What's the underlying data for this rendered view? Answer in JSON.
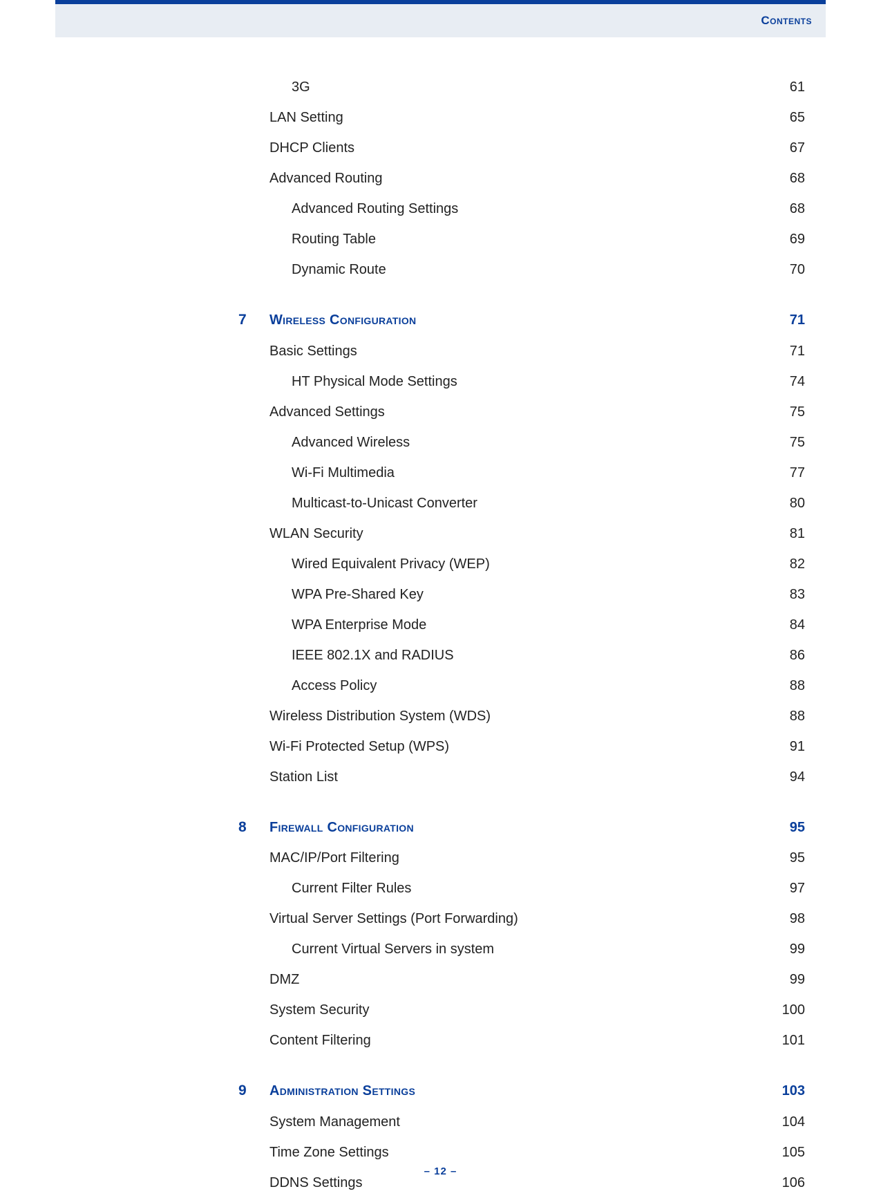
{
  "header": {
    "label": "Contents"
  },
  "footer": {
    "page_label": "–  12  –"
  },
  "toc": [
    {
      "level": 2,
      "label": "3G",
      "page": "61"
    },
    {
      "level": 1,
      "label": "LAN Setting",
      "page": "65"
    },
    {
      "level": 1,
      "label": "DHCP Clients",
      "page": "67"
    },
    {
      "level": 1,
      "label": "Advanced Routing",
      "page": "68"
    },
    {
      "level": 2,
      "label": "Advanced Routing Settings",
      "page": "68"
    },
    {
      "level": 2,
      "label": "Routing Table",
      "page": "69"
    },
    {
      "level": 2,
      "label": "Dynamic Route",
      "page": "70"
    },
    {
      "level": 0,
      "chapter_num": "7",
      "label": "Wireless Configuration",
      "page": "71"
    },
    {
      "level": 1,
      "label": "Basic Settings",
      "page": "71"
    },
    {
      "level": 2,
      "label": "HT Physical Mode Settings",
      "page": "74"
    },
    {
      "level": 1,
      "label": "Advanced Settings",
      "page": "75"
    },
    {
      "level": 2,
      "label": "Advanced Wireless",
      "page": "75"
    },
    {
      "level": 2,
      "label": "Wi-Fi Multimedia",
      "page": "77"
    },
    {
      "level": 2,
      "label": "Multicast-to-Unicast Converter",
      "page": "80"
    },
    {
      "level": 1,
      "label": "WLAN Security",
      "page": "81"
    },
    {
      "level": 2,
      "label": "Wired Equivalent Privacy (WEP)",
      "page": "82"
    },
    {
      "level": 2,
      "label": "WPA Pre-Shared Key",
      "page": "83"
    },
    {
      "level": 2,
      "label": "WPA Enterprise Mode",
      "page": "84"
    },
    {
      "level": 2,
      "label": "IEEE 802.1X and RADIUS",
      "page": "86"
    },
    {
      "level": 2,
      "label": "Access Policy",
      "page": "88"
    },
    {
      "level": 1,
      "label": "Wireless Distribution System (WDS)",
      "page": "88"
    },
    {
      "level": 1,
      "label": "Wi-Fi Protected Setup (WPS)",
      "page": "91"
    },
    {
      "level": 1,
      "label": "Station List",
      "page": "94"
    },
    {
      "level": 0,
      "chapter_num": "8",
      "label": "Firewall Configuration",
      "page": "95"
    },
    {
      "level": 1,
      "label": "MAC/IP/Port Filtering",
      "page": "95"
    },
    {
      "level": 2,
      "label": "Current Filter Rules",
      "page": "97"
    },
    {
      "level": 1,
      "label": "Virtual Server Settings (Port Forwarding)",
      "page": "98"
    },
    {
      "level": 2,
      "label": "Current Virtual Servers in system",
      "page": "99"
    },
    {
      "level": 1,
      "label": "DMZ",
      "page": "99"
    },
    {
      "level": 1,
      "label": "System Security",
      "page": "100"
    },
    {
      "level": 1,
      "label": "Content Filtering",
      "page": "101"
    },
    {
      "level": 0,
      "chapter_num": "9",
      "label": "Administration Settings",
      "page": "103"
    },
    {
      "level": 1,
      "label": "System Management",
      "page": "104"
    },
    {
      "level": 1,
      "label": "Time Zone Settings",
      "page": "105"
    },
    {
      "level": 1,
      "label": "DDNS Settings",
      "page": "106"
    }
  ]
}
